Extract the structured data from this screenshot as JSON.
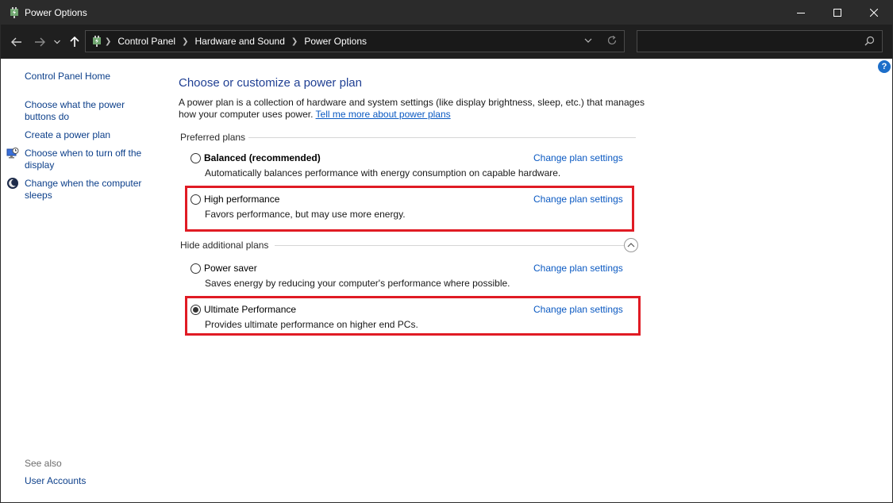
{
  "window": {
    "title": "Power Options"
  },
  "address": {
    "breadcrumbs": [
      "Control Panel",
      "Hardware and Sound",
      "Power Options"
    ],
    "search_placeholder": ""
  },
  "help": {
    "label": "?"
  },
  "sidebar": {
    "links": [
      {
        "label": "Control Panel Home",
        "icon": ""
      },
      {
        "label": "Choose what the power buttons do",
        "icon": ""
      },
      {
        "label": "Create a power plan",
        "icon": ""
      },
      {
        "label": "Choose when to turn off the display",
        "icon": "monitor-clock-icon"
      },
      {
        "label": "Change when the computer sleeps",
        "icon": "moon-sleep-icon"
      }
    ],
    "see_also": "See also",
    "see_also_links": [
      {
        "label": "User Accounts"
      }
    ]
  },
  "main": {
    "title": "Choose or customize a power plan",
    "description": "A power plan is a collection of hardware and system settings (like display brightness, sleep, etc.) that manages how your computer uses power.",
    "learn_more": "Tell me more about power plans",
    "preferred_header": "Preferred plans",
    "additional_header": "Hide additional plans",
    "change_link": "Change plan settings",
    "plans": [
      {
        "name": "Balanced (recommended)",
        "description": "Automatically balances performance with energy consumption on capable hardware.",
        "selected": false
      },
      {
        "name": "High performance",
        "description": "Favors performance, but may use more energy.",
        "selected": false
      },
      {
        "name": "Power saver",
        "description": "Saves energy by reducing your computer's performance where possible.",
        "selected": false
      },
      {
        "name": "Ultimate Performance",
        "description": "Provides ultimate performance on higher end PCs.",
        "selected": true
      }
    ]
  },
  "colors": {
    "titlebar": "#2b2b2b",
    "addressbar": "#1f1f1f",
    "link": "#0a59c2",
    "highlight": "#e01b24"
  }
}
